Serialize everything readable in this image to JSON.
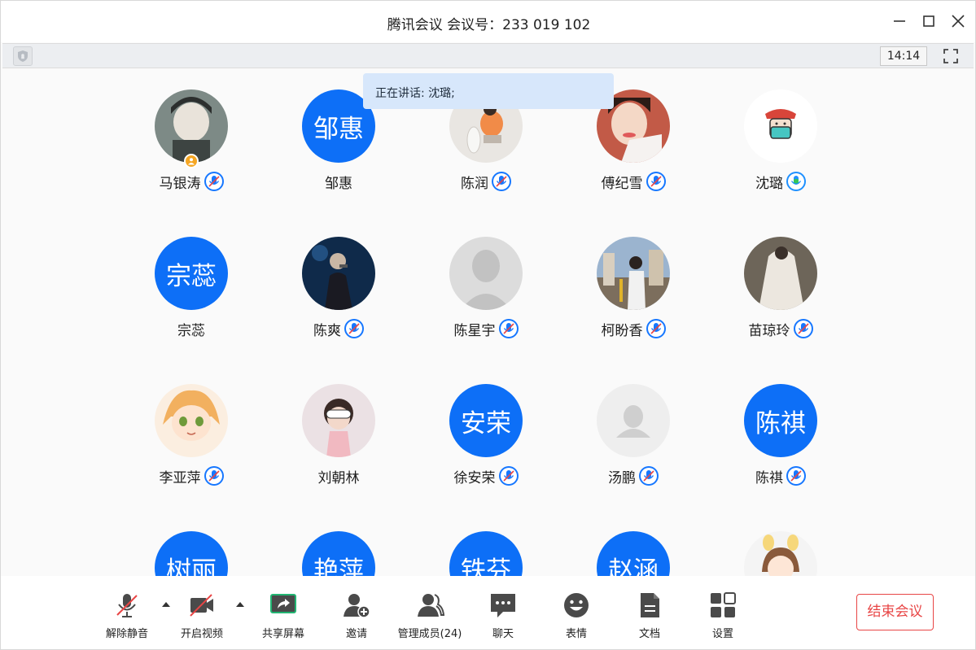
{
  "window": {
    "title": "腾讯会议 会议号：233 019 102"
  },
  "infobar": {
    "time": "14:14"
  },
  "speaking": {
    "text": "正在讲话: 沈璐;"
  },
  "participants": [
    {
      "name": "马银涛",
      "avatar_type": "photo",
      "mic": "muted",
      "host": true
    },
    {
      "name": "邹惠",
      "avatar_type": "text",
      "avatar_text": "邹惠",
      "mic": "none"
    },
    {
      "name": "陈润",
      "avatar_type": "photo",
      "mic": "muted"
    },
    {
      "name": "傅纪雪",
      "avatar_type": "photo",
      "mic": "muted"
    },
    {
      "name": "沈璐",
      "avatar_type": "photo",
      "mic": "active"
    },
    {
      "name": "宗蕊",
      "avatar_type": "text",
      "avatar_text": "宗蕊",
      "mic": "none"
    },
    {
      "name": "陈爽",
      "avatar_type": "photo",
      "mic": "muted"
    },
    {
      "name": "陈星宇",
      "avatar_type": "placeholder-dark",
      "mic": "muted"
    },
    {
      "name": "柯盼香",
      "avatar_type": "photo",
      "mic": "muted"
    },
    {
      "name": "苗琼玲",
      "avatar_type": "photo",
      "mic": "muted"
    },
    {
      "name": "李亚萍",
      "avatar_type": "photo",
      "mic": "muted"
    },
    {
      "name": "刘朝林",
      "avatar_type": "photo",
      "mic": "none"
    },
    {
      "name": "徐安荣",
      "avatar_type": "text",
      "avatar_text": "安荣",
      "mic": "muted"
    },
    {
      "name": "汤鹏",
      "avatar_type": "placeholder-light",
      "mic": "muted"
    },
    {
      "name": "陈祺",
      "avatar_type": "text",
      "avatar_text": "陈祺",
      "mic": "muted"
    },
    {
      "name": "",
      "avatar_type": "text",
      "avatar_text": "树丽",
      "mic": "none"
    },
    {
      "name": "",
      "avatar_type": "text",
      "avatar_text": "艳萍",
      "mic": "none"
    },
    {
      "name": "",
      "avatar_type": "text",
      "avatar_text": "铁芬",
      "mic": "none"
    },
    {
      "name": "",
      "avatar_type": "text",
      "avatar_text": "赵涵",
      "mic": "none"
    },
    {
      "name": "",
      "avatar_type": "photo",
      "mic": "none"
    }
  ],
  "toolbar": {
    "unmute_label": "解除静音",
    "video_label": "开启视频",
    "share_label": "共享屏幕",
    "invite_label": "邀请",
    "members_label": "管理成员(24)",
    "chat_label": "聊天",
    "emoji_label": "表情",
    "docs_label": "文档",
    "settings_label": "设置",
    "end_label": "结束会议"
  },
  "colors": {
    "accent": "#0d6ff7",
    "muted_mic": "#1677ff",
    "active_mic": "#1e90ff",
    "end_red": "#e84545",
    "host_badge": "#f5a623"
  }
}
